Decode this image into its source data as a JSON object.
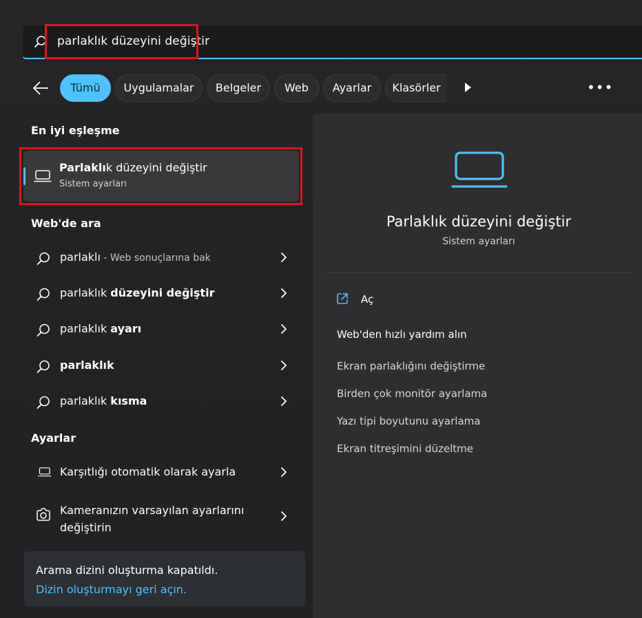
{
  "search": {
    "query": "parlaklık düzeyini değiştir"
  },
  "filters": {
    "tabs": [
      {
        "label": "Tümü"
      },
      {
        "label": "Uygulamalar"
      },
      {
        "label": "Belgeler"
      },
      {
        "label": "Web"
      },
      {
        "label": "Ayarlar"
      },
      {
        "label": "Klasörler"
      }
    ],
    "more_label": "•••"
  },
  "best_match": {
    "heading": "En iyi eşleşme",
    "title_bold": "Parlaklı",
    "title_rest": "k düzeyini değiştir",
    "subtitle": "Sistem ayarları"
  },
  "web": {
    "heading": "Web'de ara",
    "items": [
      {
        "plain": "parlaklı",
        "bold": "",
        "hint": " - Web sonuçlarına bak"
      },
      {
        "plain": "parlaklık ",
        "bold": "düzeyini değiştir",
        "hint": ""
      },
      {
        "plain": "parlaklık ",
        "bold": "ayarı",
        "hint": ""
      },
      {
        "plain": "parlaklık",
        "bold": "",
        "hint": ""
      },
      {
        "plain": "parlaklık ",
        "bold": "kısma",
        "hint": ""
      }
    ]
  },
  "settings": {
    "heading": "Ayarlar",
    "items": [
      {
        "label": "Karşıtlığı otomatik olarak ayarla"
      },
      {
        "label_line1": "Kameranızın varsayılan ayarlarını",
        "label_line2": "değiştirin"
      }
    ]
  },
  "notice": {
    "text": "Arama dizini oluşturma kapatıldı.",
    "link": "Dizin oluşturmayı geri açın."
  },
  "preview": {
    "title": "Parlaklık düzeyini değiştir",
    "subtitle": "Sistem ayarları",
    "open_label": "Aç",
    "help_heading": "Web'den hızlı yardım alın",
    "links": [
      "Ekran parlaklığını değiştirme",
      "Birden çok monitör ayarlama",
      "Yazı tipi boyutunu ayarlama",
      "Ekran titreşimini düzeltme"
    ]
  },
  "colors": {
    "accent": "#4cc2ff",
    "highlight_box": "#e0141c",
    "background": "#202020"
  }
}
